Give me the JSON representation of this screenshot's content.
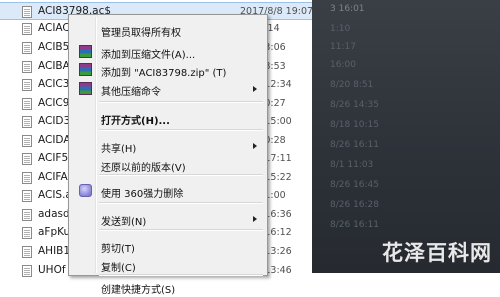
{
  "files": [
    {
      "name": "ACI83798.ac$",
      "date": "2017/8/8 19:07",
      "selected": true
    },
    {
      "name": "ACIAC",
      "date": "8/8 8:14"
    },
    {
      "name": "ACIB5",
      "date": "8/8 13:06"
    },
    {
      "name": "ACIBA",
      "date": "8/20 8:53"
    },
    {
      "name": "ACIC3",
      "date": "8/27 12:34"
    },
    {
      "name": "ACIC9",
      "date": "8/8 10:27"
    },
    {
      "name": "ACID3",
      "date": "8/19 15:00"
    },
    {
      "name": "ACIDA",
      "date": "8/8 10:28"
    },
    {
      "name": "ACIF52",
      "date": "8/19 17:11"
    },
    {
      "name": "ACIFAE",
      "date": "8/19 15:22"
    },
    {
      "name": "ACIS.a",
      "date": "8/8 11:00"
    },
    {
      "name": "adasd",
      "date": "8/26 16:36"
    },
    {
      "name": "aFpKu",
      "date": "8/24 16:12"
    },
    {
      "name": "AHIB1",
      "date": "8/24 13:26"
    },
    {
      "name": "UHOf",
      "date": "8/24 13:46"
    }
  ],
  "dark_panel": {
    "lines": [
      "3 16:01",
      "1:10",
      "11:17",
      "16:00",
      "8/20 8:51",
      "8/26 14:35",
      "8/18 10:15",
      "8/26 16:11",
      "8/1 11:03",
      "8/26 16:45",
      "8/26 16:28",
      "8/26 16:11"
    ],
    "watermark": "花泽百科网"
  },
  "context_menu": {
    "items": [
      {
        "label": "管理员取得所有权",
        "icon": null,
        "arrow": false,
        "bold": false
      },
      {
        "label": "添加到压缩文件(A)...",
        "icon": "rar-icon",
        "arrow": false,
        "bold": false
      },
      {
        "label": "添加到 \"ACI83798.zip\" (T)",
        "icon": "rar-icon",
        "arrow": false,
        "bold": false
      },
      {
        "label": "其他压缩命令",
        "icon": "rar-icon",
        "arrow": true,
        "bold": false
      },
      {
        "label": "打开方式(H)...",
        "icon": null,
        "arrow": false,
        "bold": true
      },
      {
        "label": "共享(H)",
        "icon": null,
        "arrow": true,
        "bold": false
      },
      {
        "label": "还原以前的版本(V)",
        "icon": null,
        "arrow": false,
        "bold": false
      },
      {
        "label": "使用 360强力删除",
        "icon": "shield-icon",
        "arrow": false,
        "bold": false
      },
      {
        "label": "发送到(N)",
        "icon": null,
        "arrow": true,
        "bold": false
      },
      {
        "label": "剪切(T)",
        "icon": null,
        "arrow": false,
        "bold": false
      },
      {
        "label": "复制(C)",
        "icon": null,
        "arrow": false,
        "bold": false
      },
      {
        "label": "创建快捷方式(S)",
        "icon": null,
        "arrow": false,
        "bold": false
      }
    ]
  },
  "colors": {
    "selection": "#dbe9f8",
    "menu_bg": "#f0f0f0",
    "dark_panel": "#2c3138"
  }
}
